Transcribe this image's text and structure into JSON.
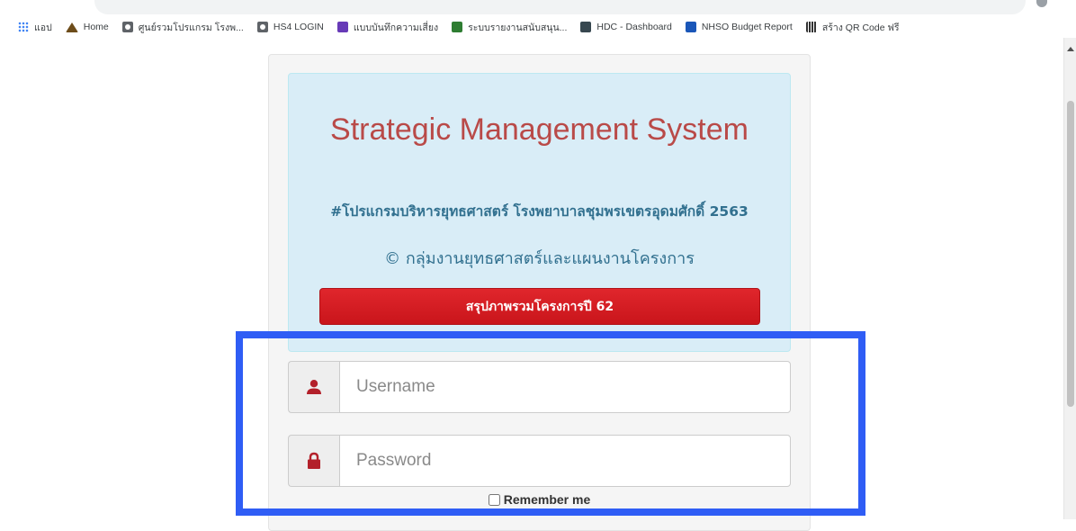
{
  "bookmarks": [
    {
      "label": "แอป",
      "icon": "apps-grid-icon"
    },
    {
      "label": "Home",
      "icon": "home-icon"
    },
    {
      "label": "ศูนย์รวมโปรแกรม โรงพ...",
      "icon": "globe-icon"
    },
    {
      "label": "HS4 LOGIN",
      "icon": "globe-icon"
    },
    {
      "label": "แบบบันทึกความเสี่ยง",
      "icon": "form-icon"
    },
    {
      "label": "ระบบรายงานสนับสนุน...",
      "icon": "green-logo-icon"
    },
    {
      "label": "HDC - Dashboard",
      "icon": "hdc-icon"
    },
    {
      "label": "NHSO Budget Report",
      "icon": "chart-icon"
    },
    {
      "label": "สร้าง QR Code ฟรี",
      "icon": "qr-icon"
    }
  ],
  "login": {
    "title": "Strategic Management System",
    "subtitle": "#โปรแกรมบริหารยุทธศาสตร์ โรงพยาบาลชุมพรเขตรอุดมศักดิ์ 2563",
    "department": "© กลุ่มงานยุทธศาสตร์และแผนงานโครงการ",
    "summary_button": "สรุปภาพรวมโครงการปี 62",
    "username_placeholder": "Username",
    "password_placeholder": "Password",
    "remember_label": "Remember me"
  },
  "colors": {
    "title": "#b94a48",
    "info": "#31708f",
    "hero_bg": "#d9edf7",
    "button": "#d9181f",
    "highlight": "#2f5df5"
  }
}
